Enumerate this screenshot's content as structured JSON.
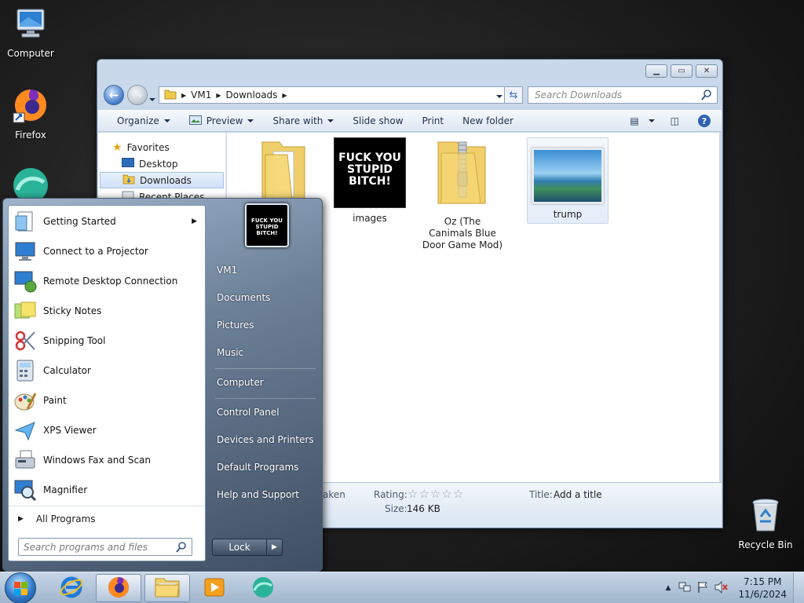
{
  "desktop": {
    "icons": [
      {
        "label": "Computer",
        "icon": "computer-icon"
      },
      {
        "label": "Firefox",
        "icon": "firefox-icon"
      },
      {
        "label": "Recycle Bin",
        "icon": "recycle-bin-icon"
      }
    ]
  },
  "explorer": {
    "address": {
      "segments": [
        "VM1",
        "Downloads"
      ]
    },
    "search_placeholder": "Search Downloads",
    "toolbar": {
      "organize": "Organize",
      "preview": "Preview",
      "share_with": "Share with",
      "slide_show": "Slide show",
      "print": "Print",
      "new_folder": "New folder"
    },
    "nav": {
      "favorites": "Favorites",
      "items": [
        "Desktop",
        "Downloads",
        "Recent Places"
      ]
    },
    "files": [
      {
        "name": "",
        "type": "folder"
      },
      {
        "name": "images",
        "type": "image-dark"
      },
      {
        "name": "Oz (The Canimals Blue Door Game Mod)",
        "type": "zip-folder"
      },
      {
        "name": "trump",
        "type": "image-landscape"
      }
    ],
    "details": {
      "date_taken_fragment": "aken",
      "rating_label": "Rating:",
      "rating_stars": 0,
      "size_label": "Size:",
      "size_value": "146 KB",
      "title_label": "Title:",
      "title_value": "Add a title"
    },
    "image_text": "FUCK YOU STUPID BITCH!"
  },
  "start_menu": {
    "programs": [
      {
        "label": "Getting Started",
        "icon": "getting-started-icon",
        "submenu": true
      },
      {
        "label": "Connect to a Projector",
        "icon": "projector-icon"
      },
      {
        "label": "Remote Desktop Connection",
        "icon": "remote-desktop-icon"
      },
      {
        "label": "Sticky Notes",
        "icon": "sticky-notes-icon"
      },
      {
        "label": "Snipping Tool",
        "icon": "snipping-tool-icon"
      },
      {
        "label": "Calculator",
        "icon": "calculator-icon"
      },
      {
        "label": "Paint",
        "icon": "paint-icon"
      },
      {
        "label": "XPS Viewer",
        "icon": "xps-viewer-icon"
      },
      {
        "label": "Windows Fax and Scan",
        "icon": "fax-scan-icon"
      },
      {
        "label": "Magnifier",
        "icon": "magnifier-icon"
      }
    ],
    "all_programs": "All Programs",
    "search_placeholder": "Search programs and files",
    "right": {
      "user": "VM1",
      "documents": "Documents",
      "pictures": "Pictures",
      "music": "Music",
      "computer": "Computer",
      "control_panel": "Control Panel",
      "devices_printers": "Devices and Printers",
      "default_programs": "Default Programs",
      "help_support": "Help and Support"
    },
    "lock_label": "Lock"
  },
  "taskbar": {
    "pinned": [
      "internet-explorer-icon",
      "firefox-icon",
      "file-explorer-icon",
      "media-player-icon",
      "app-icon"
    ],
    "clock_time": "7:15 PM",
    "clock_date": "11/6/2024"
  }
}
